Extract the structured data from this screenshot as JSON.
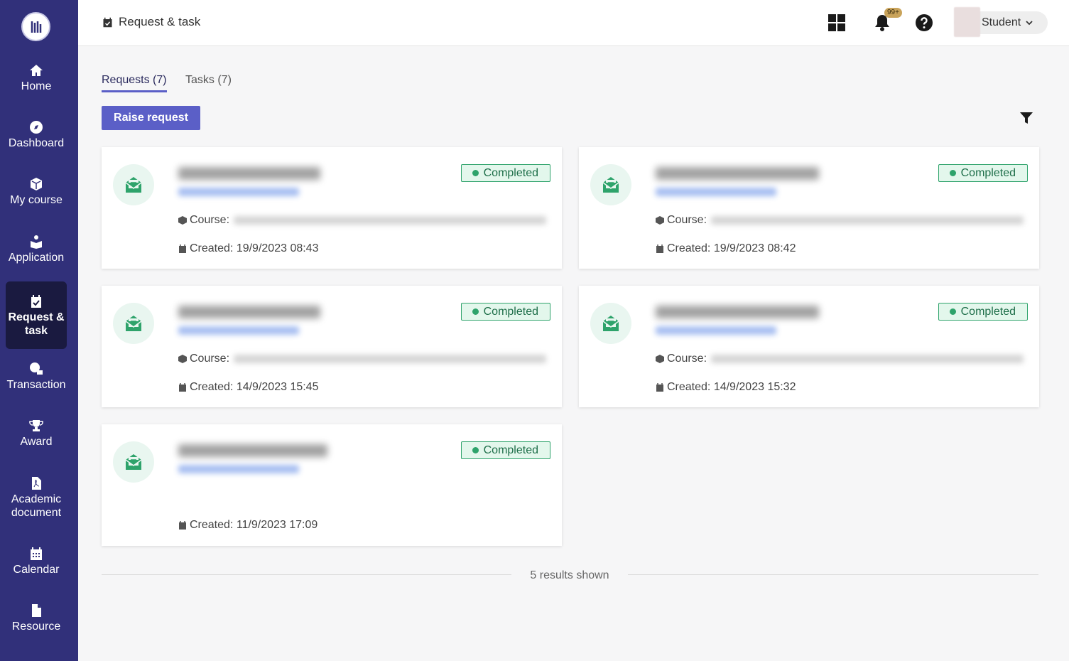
{
  "sidebar": {
    "logo_icon": "university-logo",
    "items": [
      {
        "label": "Home",
        "icon": "home-icon",
        "active": false
      },
      {
        "label": "Dashboard",
        "icon": "compass-icon",
        "active": false
      },
      {
        "label": "My course",
        "icon": "cube-icon",
        "active": false
      },
      {
        "label": "Application",
        "icon": "user-book-icon",
        "active": false
      },
      {
        "label": "Request & task",
        "icon": "calendar-check-icon",
        "active": true
      },
      {
        "label": "Transaction",
        "icon": "transaction-icon",
        "active": false
      },
      {
        "label": "Award",
        "icon": "trophy-icon",
        "active": false
      },
      {
        "label": "Academic document",
        "icon": "pdf-file-icon",
        "active": false
      },
      {
        "label": "Calendar",
        "icon": "calendar-icon",
        "active": false
      },
      {
        "label": "Resource",
        "icon": "file-icon",
        "active": false
      }
    ]
  },
  "header": {
    "title": "Request & task",
    "notification_count": "99+",
    "user_name": "Student"
  },
  "tabs": [
    {
      "label": "Requests (7)",
      "active": true
    },
    {
      "label": "Tasks (7)",
      "active": false
    }
  ],
  "toolbar": {
    "raise_label": "Raise request"
  },
  "cards": [
    {
      "status": "Completed",
      "course_label": "Course:",
      "created": "Created: 19/9/2023 08:43",
      "has_course": true
    },
    {
      "status": "Completed",
      "course_label": "Course:",
      "created": "Created: 19/9/2023 08:42",
      "has_course": true
    },
    {
      "status": "Completed",
      "course_label": "Course:",
      "created": "Created: 14/9/2023 15:45",
      "has_course": true
    },
    {
      "status": "Completed",
      "course_label": "Course:",
      "created": "Created: 14/9/2023 15:32",
      "has_course": true
    },
    {
      "status": "Completed",
      "course_label": "",
      "created": "Created: 11/9/2023 17:09",
      "has_course": false
    }
  ],
  "results": {
    "text": "5 results shown"
  },
  "colors": {
    "sidebar": "#31307a",
    "accent": "#5b5fc7",
    "status_green": "#2ea36b"
  }
}
